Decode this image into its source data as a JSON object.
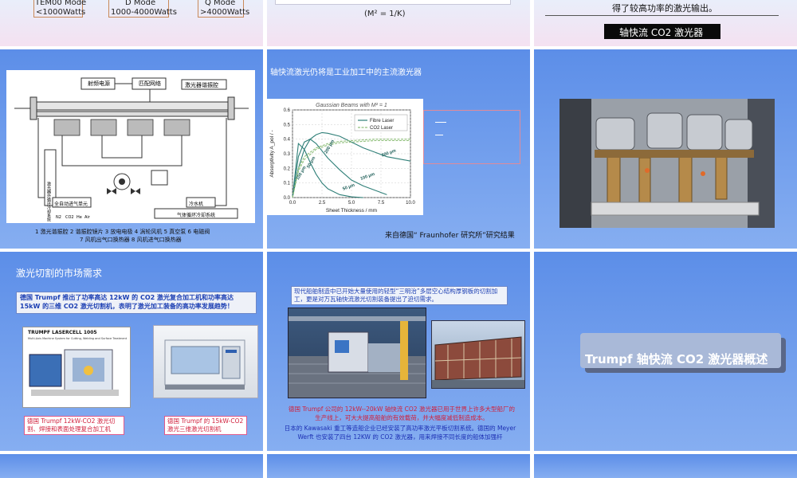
{
  "top_row": {
    "modes": [
      {
        "name": "TEM00 Mode",
        "range": "<1000Watts"
      },
      {
        "name": "D Mode",
        "range": "1000-4000Watts"
      },
      {
        "name": "Q Mode",
        "range": ">4000Watts"
      }
    ],
    "formula": "(M² = 1/K)",
    "caption": "得了较高功率的激光输出。",
    "title_box": "轴快流 CO2 激光器"
  },
  "slide_diagram": {
    "labels": {
      "rf_power": "射频电源",
      "match": "匹配网络",
      "head": "激光器谐振腔",
      "side": "激光器外循环冷却系统",
      "gas_unit": "全自动进气单元",
      "chiller": "冷水机",
      "gas_cooling": "气体循环冷却系统",
      "gases": [
        "N2",
        "CO2",
        "He",
        "Air"
      ]
    },
    "legend_line1": "1 激光谐振腔   2 谐振腔镜片   3 放电电极   4 涡轮风机   5 真空泵   6 电磁阀",
    "legend_line2": "7 风机出气口换热器   8 风机进气口换热器"
  },
  "slide_chart": {
    "heading": "轴快流激光仍将是工业加工中的主流激光器",
    "source": "来自德国“ Fraunhofer 研究所”研究结果"
  },
  "chart_data": {
    "type": "line",
    "title": "Gaussian Beams with M² = 1",
    "xlabel": "Sheet Thickness / mm",
    "ylabel": "Absorptivity A_pol / -",
    "xlim": [
      0,
      10
    ],
    "ylim": [
      0,
      0.6
    ],
    "xticks": [
      "0.0",
      "2.5",
      "5.0",
      "7.5",
      "10.0"
    ],
    "yticks": [
      "0.0",
      "0.1",
      "0.2",
      "0.3",
      "0.4",
      "0.5",
      "0.6"
    ],
    "legend": [
      "Fibre Laser",
      "CO2 Laser"
    ],
    "legend_position": "top-right",
    "series": [
      {
        "name": "Fibre Laser",
        "annotation": "200 µm",
        "color": "#2f7f78",
        "x": [
          0,
          0.5,
          1,
          1.5,
          2,
          2.5,
          3,
          4,
          5,
          6,
          7,
          8,
          9,
          10
        ],
        "y": [
          0.0,
          0.2,
          0.33,
          0.4,
          0.43,
          0.445,
          0.44,
          0.42,
          0.38,
          0.34,
          0.31,
          0.28,
          0.265,
          0.25
        ]
      },
      {
        "name": "Fibre Laser",
        "annotation": "100 µm",
        "color": "#2f7f78",
        "x": [
          0,
          0.5,
          1,
          1.5,
          2,
          2.5,
          3,
          4,
          5,
          6,
          7,
          8
        ],
        "y": [
          0.0,
          0.28,
          0.38,
          0.4,
          0.37,
          0.32,
          0.27,
          0.19,
          0.12,
          0.08,
          0.05,
          0.02
        ]
      },
      {
        "name": "Fibre Laser",
        "annotation": "50 µm",
        "color": "#2f7f78",
        "x": [
          0,
          0.5,
          1,
          1.5,
          2,
          2.5,
          3,
          4,
          5,
          6
        ],
        "y": [
          0.0,
          0.37,
          0.33,
          0.24,
          0.16,
          0.1,
          0.06,
          0.02,
          0.005,
          0.0
        ]
      },
      {
        "name": "CO2 Laser",
        "annotation": "",
        "color": "#8fbf7a",
        "x": [
          0,
          0.5,
          1,
          2,
          3,
          4,
          5,
          6,
          7,
          8,
          9,
          10
        ],
        "y": [
          0.0,
          0.2,
          0.28,
          0.34,
          0.37,
          0.385,
          0.39,
          0.395,
          0.4,
          0.4,
          0.4,
          0.4
        ]
      },
      {
        "name": "CO2 Laser",
        "annotation": "",
        "color": "#8fbf7a",
        "x": [
          0,
          0.5,
          1,
          2,
          3,
          4,
          5,
          6,
          7,
          8,
          9,
          10
        ],
        "y": [
          0.0,
          0.18,
          0.26,
          0.33,
          0.36,
          0.375,
          0.38,
          0.385,
          0.39,
          0.39,
          0.39,
          0.39
        ]
      }
    ],
    "annotations": [
      "200 µm",
      "100 µm",
      "50 µm",
      "200 µm",
      "100 µm",
      "50 µm"
    ]
  },
  "slide_market": {
    "heading": "激光切割的市场需求",
    "highlight": "德国 Trumpf 推出了功率高达 12kW 的 CO2 激光复合加工机和功率高达 15kW 的三维 CO2 激光切割机，表明了激光加工装备的高功率发展趋势！",
    "brochure_title": "TRUMPF LASERCELL 1005",
    "brochure_sub": "Multi-Axis Machine System for Cutting, Welding and Surface Treatment",
    "caption_left": "德国 Trumpf 12kW-CO2 激光切割、焊接和表面处理复合加工机",
    "caption_right": "德国 Trumpf 的 15kW-CO2 激光三维激光切割机"
  },
  "slide_ship": {
    "intro": "现代船舶制造中已开始大量使用的轻型“三明治”多层空心结构厚钢板的切割加工，更是对万瓦轴快流激光切割装备提出了迫切需求。",
    "red_text": "德国 Trumpf 公司的 12kW--20kW 轴快流 CO2 激光器已用于世界上许多大型船厂的生产线上，可大大提高船舶的有效载荷，并大幅度减低制造成本。",
    "blue_text": "日本的 Kawasaki 重工等造船企业已经安装了高功率激光平板切割系统。德国的 Meyer Werft 也安装了四台 12KW 的 CO2 激光器，用来焊接不同长度的船体加强杆"
  },
  "slide_title": {
    "title": "Trumpf 轴快流 CO2 激光器概述"
  }
}
